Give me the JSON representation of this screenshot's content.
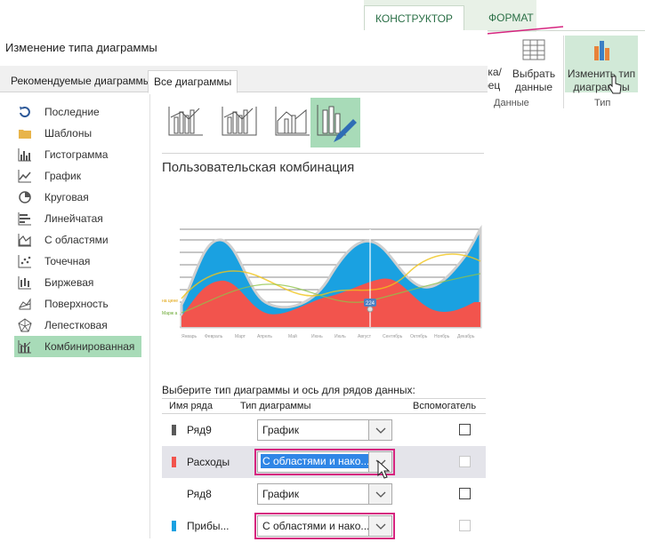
{
  "ribbon": {
    "tabs": [
      "КОНСТРУКТОР",
      "ФОРМАТ"
    ],
    "buttons": {
      "switch_partial": [
        "рока/",
        "лбец"
      ],
      "select_data": [
        "Выбрать",
        "данные"
      ],
      "change_type": [
        "Изменить тип",
        "диаграммы"
      ]
    },
    "groups": {
      "data": "Данные",
      "type": "Тип"
    }
  },
  "dialog": {
    "title": "Изменение типа диаграммы",
    "tabs": [
      "Рекомендуемые диаграммы",
      "Все диаграммы"
    ],
    "sidebar": [
      {
        "label": "Последние",
        "icon": "recent-icon"
      },
      {
        "label": "Шаблоны",
        "icon": "folder-icon"
      },
      {
        "label": "Гистограмма",
        "icon": "column-chart-icon"
      },
      {
        "label": "График",
        "icon": "line-chart-icon"
      },
      {
        "label": "Круговая",
        "icon": "pie-chart-icon"
      },
      {
        "label": "Линейчатая",
        "icon": "bar-chart-icon"
      },
      {
        "label": "С областями",
        "icon": "area-chart-icon"
      },
      {
        "label": "Точечная",
        "icon": "scatter-chart-icon"
      },
      {
        "label": "Биржевая",
        "icon": "stock-chart-icon"
      },
      {
        "label": "Поверхность",
        "icon": "surface-chart-icon"
      },
      {
        "label": "Лепестковая",
        "icon": "radar-chart-icon"
      },
      {
        "label": "Комбинированная",
        "icon": "combo-chart-icon",
        "active": true
      }
    ],
    "combo_title": "Пользовательская комбинация",
    "series_prompt": "Выберите тип диаграммы и ось для рядов данных:",
    "columns": {
      "name": "Имя ряда",
      "type": "Тип диаграммы",
      "secondary": "Вспомогатель"
    },
    "rows": [
      {
        "name": "Ряд9",
        "type": "График",
        "color": "#595959"
      },
      {
        "name": "Расходы",
        "type": "С областями и нако...",
        "color": "#f2544d"
      },
      {
        "name": "Ряд8",
        "type": "График",
        "color": ""
      },
      {
        "name": "Прибы...",
        "type": "С областями и нако...",
        "color": "#1aa1e1"
      }
    ],
    "preview": {
      "months": [
        "Январь",
        "Февраль",
        "Март",
        "Апрель",
        "Май",
        "Июнь",
        "Июль",
        "Август",
        "Сентябрь",
        "Октябрь",
        "Ноябрь",
        "Декабрь"
      ],
      "badge": "224",
      "left_labels": [
        "на цене",
        "Марж а"
      ]
    }
  },
  "colors": {
    "accent": "#a8dbb8",
    "highlight": "#d6247f",
    "blue": "#1aa1e1",
    "red": "#f2544d",
    "yellow": "#f0c419"
  }
}
